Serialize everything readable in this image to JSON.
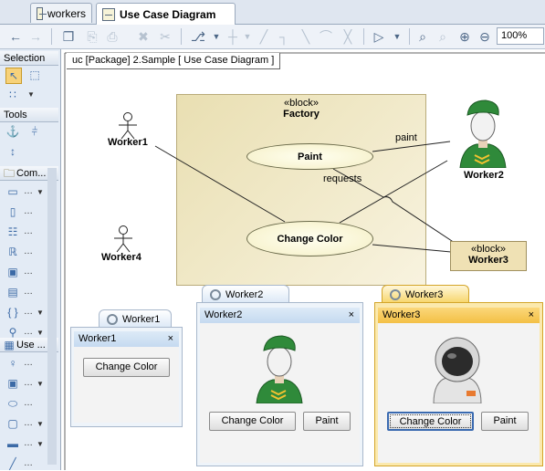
{
  "tabs": [
    {
      "label": "workers",
      "active": false
    },
    {
      "label": "Use Case Diagram",
      "active": true
    }
  ],
  "toolbar": {
    "zoom": "100%"
  },
  "palette": {
    "sections": [
      "Selection",
      "Tools",
      "Com...",
      "Use ..."
    ]
  },
  "diagram": {
    "frame_label": "uc [Package] 2.Sample [ Use Case Diagram ]",
    "factory": {
      "stereotype": "«block»",
      "name": "Factory"
    },
    "use_cases": [
      "Paint",
      "Change Color"
    ],
    "actors": [
      "Worker1",
      "Worker2",
      "Worker4"
    ],
    "worker3": {
      "stereotype": "«block»",
      "name": "Worker3"
    },
    "edge_labels": {
      "paint": "paint",
      "requests": "requests"
    }
  },
  "windows": {
    "w1": {
      "tab": "Worker1",
      "title": "Worker1",
      "close": "×",
      "change_color": "Change Color"
    },
    "w2": {
      "tab": "Worker2",
      "title": "Worker2",
      "close": "×",
      "change_color": "Change Color",
      "paint": "Paint"
    },
    "w3": {
      "tab": "Worker3",
      "title": "Worker3",
      "close": "×",
      "change_color": "Change Color",
      "paint": "Paint"
    }
  },
  "colors": {
    "accent": "#f0c040",
    "window_blue": "#c5daf0"
  }
}
